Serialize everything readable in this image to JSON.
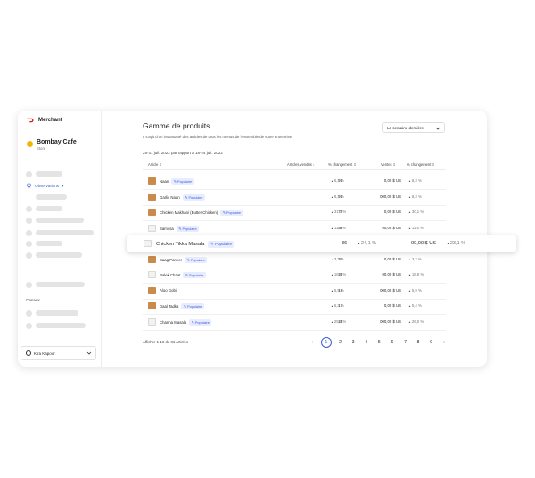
{
  "app": {
    "brand": "Merchant"
  },
  "store": {
    "name": "Bombay Cafe",
    "type": "Store"
  },
  "sidebar": {
    "observations_label": "Observations",
    "canaux_label": "Canaux"
  },
  "user": {
    "name": "Kira Kapoor"
  },
  "page": {
    "title": "Gamme de produits",
    "subtitle": "Il s'agit d'un instantané des articles de tous les menus de l'ensemble de votre entreprise.",
    "date_range": "25-31 juil. 2022 par rapport à 18-24 juil. 2022",
    "period_select": "La semaine dernière"
  },
  "table": {
    "columns": [
      "Article",
      "Articles vendus",
      "% changement",
      "Ventes",
      "% changement"
    ],
    "badge": "Populaire",
    "rows": [
      {
        "name": "Naan",
        "badge": true,
        "sold": "91",
        "change1": "6,3 %",
        "sales": "0,00 $ US",
        "change2": "8,3 %",
        "thumb": "food"
      },
      {
        "name": "Garlic Naan",
        "badge": true,
        "sold": "91",
        "change1": "8,3 %",
        "sales": "000,00 $ US",
        "change2": "8,3 %",
        "thumb": "food"
      },
      {
        "name": "Chicken Makhani (Butter Chicken)",
        "badge": true,
        "sold": "79",
        "change1": "31,7 %",
        "sales": "0,00 $ US",
        "change2": "30,1 %",
        "thumb": "food"
      },
      {
        "name": "Samosa",
        "badge": true,
        "sold": "58",
        "change1": "11,5 %",
        "sales": "00,00 $ US",
        "change2": "11,5 %",
        "thumb": "empty"
      },
      {
        "name": "Saag Paneer",
        "badge": true,
        "sold": "30",
        "change1": "3,2 %",
        "sales": "0,00 $ US",
        "change2": "3,2 %",
        "thumb": "food"
      },
      {
        "name": "Palek Chaat",
        "badge": true,
        "sold": "19",
        "change1": "18,8 %",
        "sales": "00,00 $ US",
        "change2": "18,8 %",
        "thumb": "empty"
      },
      {
        "name": "Aloo Gobi",
        "badge": false,
        "sold": "18",
        "change1": "5,9 %",
        "sales": "000,00 $ US",
        "change2": "5,9 %",
        "thumb": "food"
      },
      {
        "name": "Daal Tadka",
        "badge": true,
        "sold": "17",
        "change1": "6,3 %",
        "sales": "0,00 $ US",
        "change2": "5,4 %",
        "thumb": "food"
      },
      {
        "name": "Channa Masala",
        "badge": true,
        "sold": "15",
        "change1": "25,0 %",
        "sales": "000,00 $ US",
        "change2": "26,0 %",
        "thumb": "empty"
      }
    ],
    "highlight": {
      "name": "Chicken Tikka Masala",
      "badge": "Populaire",
      "sold": "36",
      "change1": "24,1 %",
      "sales": "00,00 $ US",
      "change2": "23,1 %"
    }
  },
  "footer": {
    "summary": "Afficher 1-10 de 81 articles"
  },
  "pagination": {
    "pages": [
      "1",
      "2",
      "3",
      "4",
      "5",
      "6",
      "7",
      "8",
      "9"
    ],
    "current": "1"
  },
  "colors": {
    "accent": "#3b5bdb",
    "brand": "#eb1700",
    "badge_bg": "#e7ecff",
    "store_dot": "#f2b705"
  },
  "icons": [
    "doordash-logo-icon",
    "lightbulb-icon",
    "chevron-down-icon",
    "user-circle-icon",
    "sort-icon",
    "chevron-left-icon",
    "chevron-right-icon",
    "tag-icon"
  ]
}
